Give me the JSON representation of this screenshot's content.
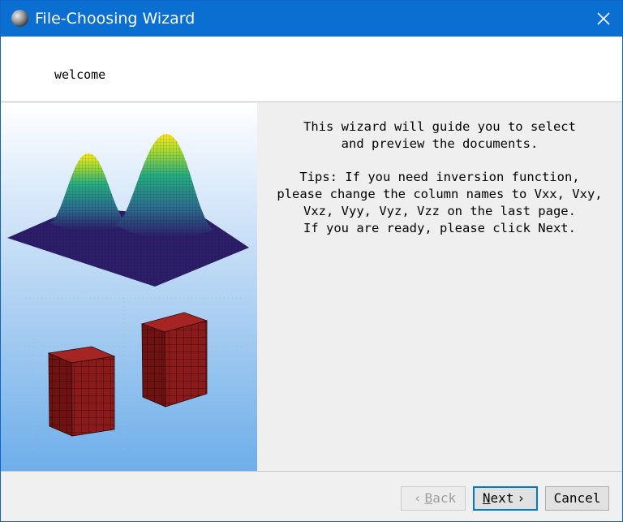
{
  "window": {
    "title": "File-Choosing Wizard"
  },
  "icons": {
    "app": "globe-icon",
    "close": "close-icon",
    "back_arrow": "chevron-left-icon",
    "next_arrow": "chevron-right-icon"
  },
  "header": {
    "text": "welcome"
  },
  "content": {
    "paragraph1": "This wizard will guide you to select\nand preview the documents.",
    "paragraph2": "Tips: If you need inversion function,\nplease change the column names to Vxx, Vxy,\nVxz, Vyy, Vyz, Vzz on the last page.\nIf you are ready, please click Next."
  },
  "footer": {
    "back": {
      "mnemonic": "B",
      "rest": "ack",
      "enabled": false
    },
    "next": {
      "mnemonic": "N",
      "rest": "ext",
      "enabled": true
    },
    "cancel": {
      "label": "Cancel",
      "enabled": true
    }
  },
  "colors": {
    "titlebar": "#0b6fd1",
    "surface_peak": "#fde725",
    "surface_base": "#2d1e6b",
    "block_fill": "#8b1a1a"
  }
}
